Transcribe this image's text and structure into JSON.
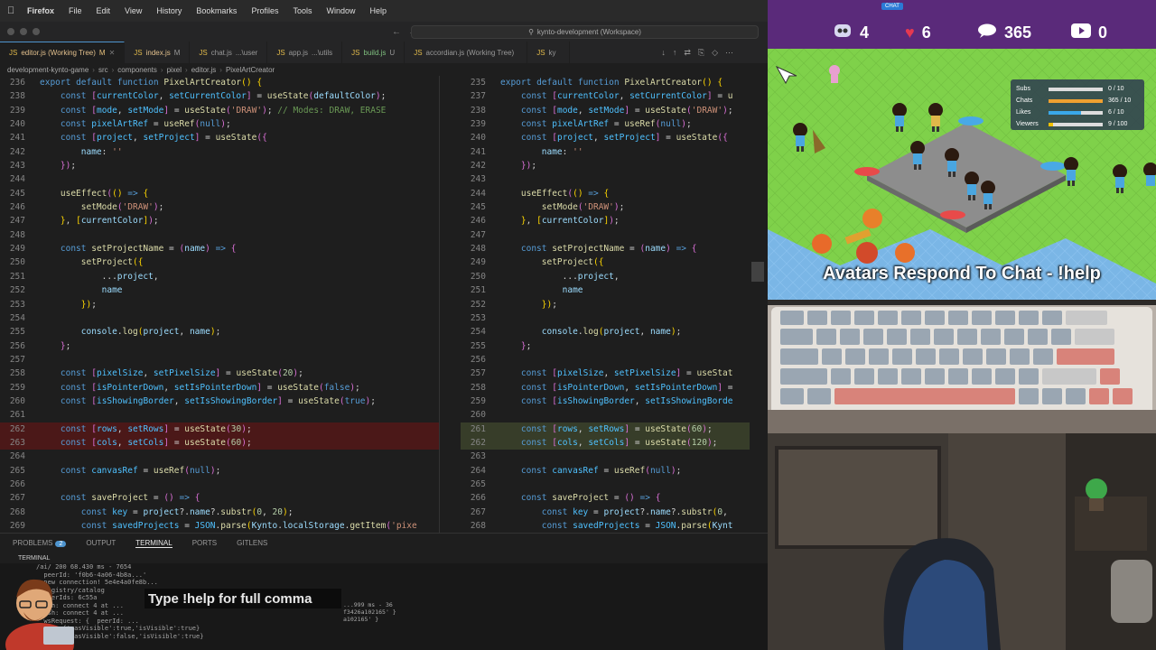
{
  "menubar": {
    "app": "Firefox",
    "items": [
      "File",
      "Edit",
      "View",
      "History",
      "Bookmarks",
      "Profiles",
      "Tools",
      "Window",
      "Help"
    ]
  },
  "titlebar": {
    "search": "kynto-development (Workspace)"
  },
  "tabs": [
    {
      "name": "editor.js (Working Tree)",
      "flag": "M",
      "state": "mod",
      "active": true
    },
    {
      "name": "index.js",
      "flag": "M",
      "state": "mod"
    },
    {
      "name": "chat.js",
      "flag": "...\\user",
      "state": "normal"
    },
    {
      "name": "app.js",
      "flag": "...\\utils",
      "state": "normal"
    },
    {
      "name": "build.js",
      "flag": "U",
      "state": "unt"
    },
    {
      "name": "accordian.js (Working Tree)",
      "flag": "",
      "state": "normal"
    },
    {
      "name": "ky",
      "flag": "",
      "state": "normal"
    }
  ],
  "breadcrumb": [
    "development-kynto-game",
    "src",
    "components",
    "pixel",
    "editor.js",
    "PixelArtCreator"
  ],
  "panel": {
    "tabs": [
      "PROBLEMS",
      "OUTPUT",
      "TERMINAL",
      "PORTS",
      "GITLENS"
    ],
    "problems_count": "2",
    "terminal_label": "TERMINAL"
  },
  "terminal": {
    "lines": [
      "/ai/ 200 68.430 ms - 7654",
      "  peerId: 'f0b6-4a06-4b8a...'",
      "  new connection! 5e4e4a0fe8b...",
      "  registry/catalog",
      "  peerIds: 6c55a",
      "  ssh: connect 4 at ...",
      "  ssh: connect 4 at ...",
      "  wsRequest: {  peerId: ...",
      "  info {'wasVisible':true,'isVisible':true}",
      "  info {'wasVisible':false,'isVisible':true}"
    ],
    "right_lines": [
      "...999 ms - 36",
      "f3426a102165' }",
      "a102165' }"
    ]
  },
  "overlay_help": "Type !help for full comma",
  "stream": {
    "pill": "CHAT",
    "stats": {
      "bots": "4",
      "likes": "6",
      "chats": "365",
      "subs": "0"
    },
    "title": "Avatars Respond To Chat - !help",
    "goals": [
      {
        "label": "Subs",
        "value": "0 / 10",
        "fill": 0.0,
        "color": "#f0c000"
      },
      {
        "label": "Chats",
        "value": "365 / 10",
        "fill": 1.0,
        "color": "#f0a030"
      },
      {
        "label": "Likes",
        "value": "6 / 10",
        "fill": 0.6,
        "color": "#3aa8e8"
      },
      {
        "label": "Viewers",
        "value": "9 / 100",
        "fill": 0.09,
        "color": "#f0c000"
      }
    ]
  },
  "left_code": [
    {
      "n": "236",
      "h": "<span class=\"kw\">export</span> <span class=\"kw\">default</span> <span class=\"kw\">function</span> <span class=\"fn\">PixelArtCreator</span><span class=\"pn\">()</span> <span class=\"pn\">{</span>"
    },
    {
      "n": "238",
      "h": "    <span class=\"kw\">const</span> <span class=\"pn2\">[</span><span class=\"cst\">currentColor</span>, <span class=\"cst\">setCurrentColor</span><span class=\"pn2\">]</span> = <span class=\"fn\">useState</span><span class=\"pn2\">(</span><span class=\"var\">defaultColor</span><span class=\"pn2\">)</span>;"
    },
    {
      "n": "239",
      "h": "    <span class=\"kw\">const</span> <span class=\"pn2\">[</span><span class=\"cst\">mode</span>, <span class=\"cst\">setMode</span><span class=\"pn2\">]</span> = <span class=\"fn\">useState</span><span class=\"pn2\">(</span><span class=\"str\">'DRAW'</span><span class=\"pn2\">)</span>; <span class=\"cmt\">// Modes: DRAW, ERASE</span>"
    },
    {
      "n": "240",
      "h": "    <span class=\"kw\">const</span> <span class=\"cst\">pixelArtRef</span> = <span class=\"fn\">useRef</span><span class=\"pn2\">(</span><span class=\"kw\">null</span><span class=\"pn2\">)</span>;"
    },
    {
      "n": "241",
      "h": "    <span class=\"kw\">const</span> <span class=\"pn2\">[</span><span class=\"cst\">project</span>, <span class=\"cst\">setProject</span><span class=\"pn2\">]</span> = <span class=\"fn\">useState</span><span class=\"pn2\">({</span>"
    },
    {
      "n": "242",
      "h": "        <span class=\"var\">name</span>: <span class=\"str\">''</span>"
    },
    {
      "n": "243",
      "h": "    <span class=\"pn2\">})</span>;"
    },
    {
      "n": "244",
      "h": ""
    },
    {
      "n": "245",
      "h": "    <span class=\"fn\">useEffect</span><span class=\"pn2\">(</span><span class=\"pn\">()</span> <span class=\"kw\">=&gt;</span> <span class=\"pn\">{</span>"
    },
    {
      "n": "246",
      "h": "        <span class=\"fn\">setMode</span><span class=\"pn2\">(</span><span class=\"str\">'DRAW'</span><span class=\"pn2\">)</span>;"
    },
    {
      "n": "247",
      "h": "    <span class=\"pn\">}</span>, <span class=\"pn\">[</span><span class=\"var\">currentColor</span><span class=\"pn\">]</span><span class=\"pn2\">)</span>;"
    },
    {
      "n": "248",
      "h": ""
    },
    {
      "n": "249",
      "h": "    <span class=\"kw\">const</span> <span class=\"fn\">setProjectName</span> = <span class=\"pn2\">(</span><span class=\"var\">name</span><span class=\"pn2\">)</span> <span class=\"kw\">=&gt;</span> <span class=\"pn2\">{</span>"
    },
    {
      "n": "250",
      "h": "        <span class=\"fn\">setProject</span><span class=\"pn\">({</span>"
    },
    {
      "n": "251",
      "h": "            ...<span class=\"var\">project</span>,"
    },
    {
      "n": "252",
      "h": "            <span class=\"var\">name</span>"
    },
    {
      "n": "253",
      "h": "        <span class=\"pn\">})</span>;"
    },
    {
      "n": "254",
      "h": ""
    },
    {
      "n": "255",
      "h": "        <span class=\"var\">console</span>.<span class=\"fn\">log</span><span class=\"pn\">(</span><span class=\"var\">project</span>, <span class=\"var\">name</span><span class=\"pn\">)</span>;"
    },
    {
      "n": "256",
      "h": "    <span class=\"pn2\">}</span>;"
    },
    {
      "n": "257",
      "h": ""
    },
    {
      "n": "258",
      "h": "    <span class=\"kw\">const</span> <span class=\"pn2\">[</span><span class=\"cst\">pixelSize</span>, <span class=\"cst\">setPixelSize</span><span class=\"pn2\">]</span> = <span class=\"fn\">useState</span><span class=\"pn2\">(</span><span class=\"num\">20</span><span class=\"pn2\">)</span>;"
    },
    {
      "n": "259",
      "h": "    <span class=\"kw\">const</span> <span class=\"pn2\">[</span><span class=\"cst\">isPointerDown</span>, <span class=\"cst\">setIsPointerDown</span><span class=\"pn2\">]</span> = <span class=\"fn\">useState</span><span class=\"pn2\">(</span><span class=\"kw\">false</span><span class=\"pn2\">)</span>;"
    },
    {
      "n": "260",
      "h": "    <span class=\"kw\">const</span> <span class=\"pn2\">[</span><span class=\"cst\">isShowingBorder</span>, <span class=\"cst\">setIsShowingBorder</span><span class=\"pn2\">]</span> = <span class=\"fn\">useState</span><span class=\"pn2\">(</span><span class=\"kw\">true</span><span class=\"pn2\">)</span>;"
    },
    {
      "n": "261",
      "h": ""
    },
    {
      "n": "262",
      "h": "    <span class=\"kw\">const</span> <span class=\"pn2\">[</span><span class=\"cst\">rows</span>, <span class=\"cst\">setRows</span><span class=\"pn2\">]</span> = <span class=\"fn\">useState</span><span class=\"pn2\">(</span><span class=\"num\">30</span><span class=\"pn2\">)</span>;",
      "t": "del"
    },
    {
      "n": "263",
      "h": "    <span class=\"kw\">const</span> <span class=\"pn2\">[</span><span class=\"cst\">cols</span>, <span class=\"cst\">setCols</span><span class=\"pn2\">]</span> = <span class=\"fn\">useState</span><span class=\"pn2\">(</span><span class=\"num\">60</span><span class=\"pn2\">)</span>;",
      "t": "del"
    },
    {
      "n": "264",
      "h": ""
    },
    {
      "n": "265",
      "h": "    <span class=\"kw\">const</span> <span class=\"cst\">canvasRef</span> = <span class=\"fn\">useRef</span><span class=\"pn2\">(</span><span class=\"kw\">null</span><span class=\"pn2\">)</span>;"
    },
    {
      "n": "266",
      "h": ""
    },
    {
      "n": "267",
      "h": "    <span class=\"kw\">const</span> <span class=\"fn\">saveProject</span> = <span class=\"pn2\">()</span> <span class=\"kw\">=&gt;</span> <span class=\"pn2\">{</span>"
    },
    {
      "n": "268",
      "h": "        <span class=\"kw\">const</span> <span class=\"cst\">key</span> = <span class=\"var\">project</span>?.<span class=\"var\">name</span>?.<span class=\"fn\">substr</span><span class=\"pn\">(</span><span class=\"num\">0</span>, <span class=\"num\">20</span><span class=\"pn\">)</span>;"
    },
    {
      "n": "269",
      "h": "        <span class=\"kw\">const</span> <span class=\"cst\">savedProjects</span> = <span class=\"cst\">JSON</span>.<span class=\"fn\">parse</span><span class=\"pn\">(</span><span class=\"var\">Kynto</span>.<span class=\"var\">localStorage</span>.<span class=\"fn\">getItem</span><span class=\"pn2\">(</span><span class=\"str\">'pixe</span>"
    }
  ],
  "right_code": [
    {
      "n": "235",
      "h": "<span class=\"kw\">export</span> <span class=\"kw\">default</span> <span class=\"kw\">function</span> <span class=\"fn\">PixelArtCreator</span><span class=\"pn\">()</span> <span class=\"pn\">{</span>"
    },
    {
      "n": "237",
      "h": "    <span class=\"kw\">const</span> <span class=\"pn2\">[</span><span class=\"cst\">currentColor</span>, <span class=\"cst\">setCurrentColor</span><span class=\"pn2\">]</span> = <span class=\"fn\">u</span>"
    },
    {
      "n": "238",
      "h": "    <span class=\"kw\">const</span> <span class=\"pn2\">[</span><span class=\"cst\">mode</span>, <span class=\"cst\">setMode</span><span class=\"pn2\">]</span> = <span class=\"fn\">useState</span><span class=\"pn2\">(</span><span class=\"str\">'DRAW'</span><span class=\"pn2\">)</span>;"
    },
    {
      "n": "239",
      "h": "    <span class=\"kw\">const</span> <span class=\"cst\">pixelArtRef</span> = <span class=\"fn\">useRef</span><span class=\"pn2\">(</span><span class=\"kw\">null</span><span class=\"pn2\">)</span>;"
    },
    {
      "n": "240",
      "h": "    <span class=\"kw\">const</span> <span class=\"pn2\">[</span><span class=\"cst\">project</span>, <span class=\"cst\">setProject</span><span class=\"pn2\">]</span> = <span class=\"fn\">useState</span><span class=\"pn2\">({</span>"
    },
    {
      "n": "241",
      "h": "        <span class=\"var\">name</span>: <span class=\"str\">''</span>"
    },
    {
      "n": "242",
      "h": "    <span class=\"pn2\">})</span>;"
    },
    {
      "n": "243",
      "h": ""
    },
    {
      "n": "244",
      "h": "    <span class=\"fn\">useEffect</span><span class=\"pn2\">(</span><span class=\"pn\">()</span> <span class=\"kw\">=&gt;</span> <span class=\"pn\">{</span>"
    },
    {
      "n": "245",
      "h": "        <span class=\"fn\">setMode</span><span class=\"pn2\">(</span><span class=\"str\">'DRAW'</span><span class=\"pn2\">)</span>;"
    },
    {
      "n": "246",
      "h": "    <span class=\"pn\">}</span>, <span class=\"pn\">[</span><span class=\"var\">currentColor</span><span class=\"pn\">]</span><span class=\"pn2\">)</span>;"
    },
    {
      "n": "247",
      "h": ""
    },
    {
      "n": "248",
      "h": "    <span class=\"kw\">const</span> <span class=\"fn\">setProjectName</span> = <span class=\"pn2\">(</span><span class=\"var\">name</span><span class=\"pn2\">)</span> <span class=\"kw\">=&gt;</span> <span class=\"pn2\">{</span>"
    },
    {
      "n": "249",
      "h": "        <span class=\"fn\">setProject</span><span class=\"pn\">({</span>"
    },
    {
      "n": "250",
      "h": "            ...<span class=\"var\">project</span>,"
    },
    {
      "n": "251",
      "h": "            <span class=\"var\">name</span>"
    },
    {
      "n": "252",
      "h": "        <span class=\"pn\">})</span>;"
    },
    {
      "n": "253",
      "h": ""
    },
    {
      "n": "254",
      "h": "        <span class=\"var\">console</span>.<span class=\"fn\">log</span><span class=\"pn\">(</span><span class=\"var\">project</span>, <span class=\"var\">name</span><span class=\"pn\">)</span>;"
    },
    {
      "n": "255",
      "h": "    <span class=\"pn2\">}</span>;"
    },
    {
      "n": "256",
      "h": ""
    },
    {
      "n": "257",
      "h": "    <span class=\"kw\">const</span> <span class=\"pn2\">[</span><span class=\"cst\">pixelSize</span>, <span class=\"cst\">setPixelSize</span><span class=\"pn2\">]</span> = <span class=\"fn\">useStat</span>"
    },
    {
      "n": "258",
      "h": "    <span class=\"kw\">const</span> <span class=\"pn2\">[</span><span class=\"cst\">isPointerDown</span>, <span class=\"cst\">setIsPointerDown</span><span class=\"pn2\">]</span> ="
    },
    {
      "n": "259",
      "h": "    <span class=\"kw\">const</span> <span class=\"pn2\">[</span><span class=\"cst\">isShowingBorder</span>, <span class=\"cst\">setIsShowingBorde</span>"
    },
    {
      "n": "260",
      "h": ""
    },
    {
      "n": "261",
      "h": "    <span class=\"kw\">const</span> <span class=\"pn2\">[</span><span class=\"cst\">rows</span>, <span class=\"cst\">setRows</span><span class=\"pn2\">]</span> = <span class=\"fn\">useState</span><span class=\"pn2\">(</span><span class=\"num\">60</span><span class=\"pn2\">)</span>;",
      "t": "add"
    },
    {
      "n": "262",
      "h": "    <span class=\"kw\">const</span> <span class=\"pn2\">[</span><span class=\"cst\">cols</span>, <span class=\"cst\">setCols</span><span class=\"pn2\">]</span> = <span class=\"fn\">useState</span><span class=\"pn2\">(</span><span class=\"num\">120</span><span class=\"pn2\">)</span>;",
      "t": "add"
    },
    {
      "n": "263",
      "h": ""
    },
    {
      "n": "264",
      "h": "    <span class=\"kw\">const</span> <span class=\"cst\">canvasRef</span> = <span class=\"fn\">useRef</span><span class=\"pn2\">(</span><span class=\"kw\">null</span><span class=\"pn2\">)</span>;"
    },
    {
      "n": "265",
      "h": ""
    },
    {
      "n": "266",
      "h": "    <span class=\"kw\">const</span> <span class=\"fn\">saveProject</span> = <span class=\"pn2\">()</span> <span class=\"kw\">=&gt;</span> <span class=\"pn2\">{</span>"
    },
    {
      "n": "267",
      "h": "        <span class=\"kw\">const</span> <span class=\"cst\">key</span> = <span class=\"var\">project</span>?.<span class=\"var\">name</span>?.<span class=\"fn\">substr</span><span class=\"pn\">(</span><span class=\"num\">0</span>,"
    },
    {
      "n": "268",
      "h": "        <span class=\"kw\">const</span> <span class=\"cst\">savedProjects</span> = <span class=\"cst\">JSON</span>.<span class=\"fn\">parse</span><span class=\"pn\">(</span><span class=\"var\">Kynt</span>"
    }
  ]
}
